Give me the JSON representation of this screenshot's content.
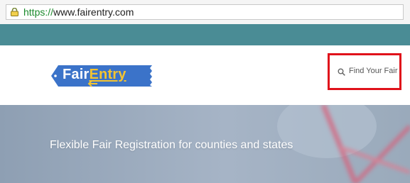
{
  "browser": {
    "url_scheme": "https://",
    "url_rest": "www.fairentry.com"
  },
  "header": {
    "logo": {
      "word_fair": "Fair",
      "word_entry": "Entry"
    },
    "find_fair_label": "Find Your Fair",
    "icons": {
      "lock": "lock-icon",
      "search": "search-icon"
    }
  },
  "hero": {
    "tagline": "Flexible Fair Registration for counties and states"
  },
  "colors": {
    "teal_strip": "#4a8c95",
    "logo_blue": "#3b73c9",
    "logo_accent": "#f4c430",
    "highlight_red": "#e0121b",
    "secure_green": "#1a8a2b"
  }
}
